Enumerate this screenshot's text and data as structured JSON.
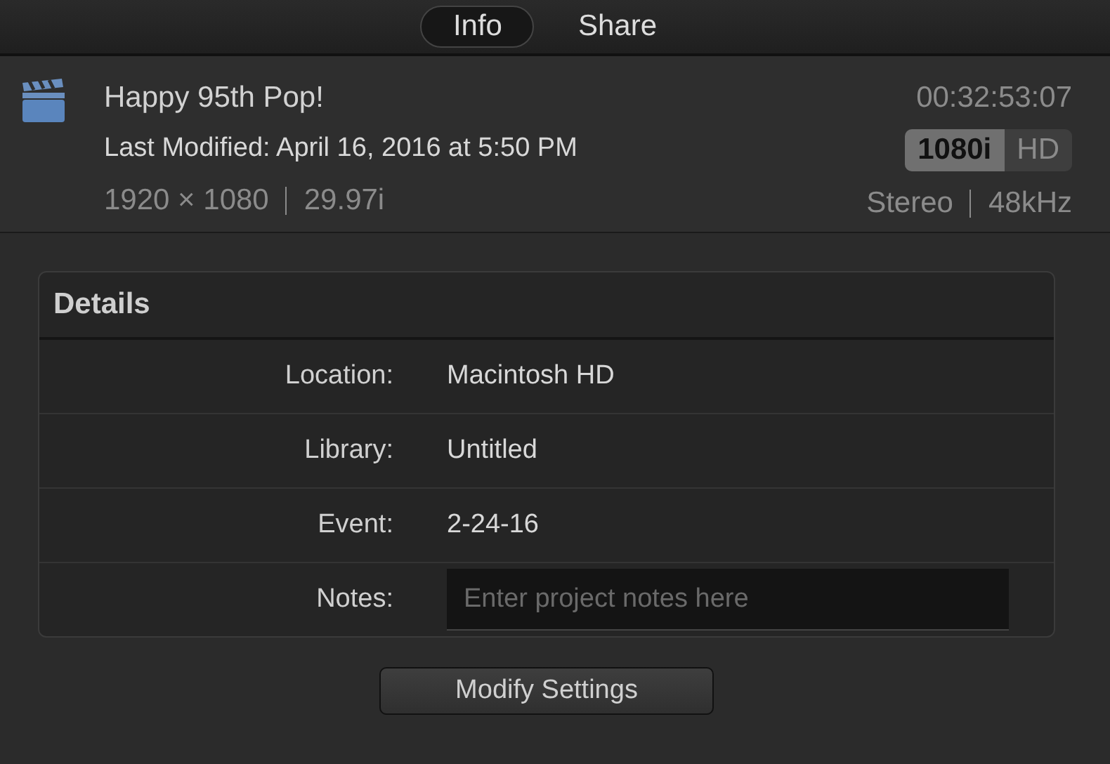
{
  "tabs": [
    {
      "label": "Info",
      "selected": true
    },
    {
      "label": "Share",
      "selected": false
    }
  ],
  "project": {
    "title": "Happy 95th Pop!",
    "modified": "Last Modified: April 16, 2016 at 5:50 PM",
    "resolution": "1920 × 1080",
    "frame_rate": "29.97i",
    "duration": "00:32:53:07",
    "format": "1080i",
    "format_class": "HD",
    "audio": "Stereo",
    "sample_rate": "48kHz"
  },
  "details": {
    "title": "Details",
    "rows": [
      {
        "kind": "text",
        "label": "Location:",
        "value": "Macintosh HD"
      },
      {
        "kind": "text",
        "label": "Library:",
        "value": "Untitled"
      },
      {
        "kind": "text",
        "label": "Event:",
        "value": "2-24-16"
      },
      {
        "kind": "field",
        "label": "Notes:",
        "placeholder": "Enter project notes here"
      }
    ]
  },
  "buttons": [
    {
      "label": "Modify Settings"
    }
  ]
}
